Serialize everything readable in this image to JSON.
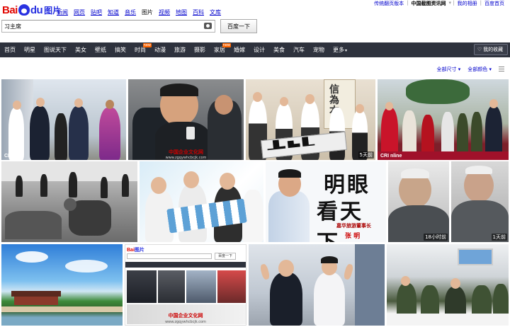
{
  "top_links": [
    "传统翻页版本",
    "中国截图资讯网",
    "我的相册",
    "百度首页"
  ],
  "logo": {
    "bai": "Bai",
    "du": "du",
    "tupian": "图片"
  },
  "channels": [
    "新闻",
    "网页",
    "贴吧",
    "知道",
    "音乐",
    "图片",
    "视频",
    "地图",
    "百科",
    "文库"
  ],
  "current_channel": "图片",
  "search": {
    "value": "习主席",
    "button": "百度一下"
  },
  "nav": [
    {
      "label": "首页"
    },
    {
      "label": "明星"
    },
    {
      "label": "图说天下"
    },
    {
      "label": "美女"
    },
    {
      "label": "壁纸"
    },
    {
      "label": "搞笑"
    },
    {
      "label": "时尚",
      "hot": "new"
    },
    {
      "label": "动漫"
    },
    {
      "label": "旅游"
    },
    {
      "label": "摄影"
    },
    {
      "label": "家居",
      "hot": "new"
    },
    {
      "label": "婚嫁"
    },
    {
      "label": "设计"
    },
    {
      "label": "美食"
    },
    {
      "label": "汽车"
    },
    {
      "label": "宠物"
    },
    {
      "label": "更多"
    }
  ],
  "favorites": "我的收藏",
  "filters": {
    "size": "全部尺寸",
    "color": "全部颜色"
  },
  "tiles": {
    "t1_wm": "CRI",
    "t2_wm": "中国企业文化网",
    "t2_url": "www.zgqywhcbcjk.com",
    "t3_badge": "5天前",
    "t4_wm": "CRI",
    "t4_wm_suffix": "nline",
    "t7_line1": "明眼",
    "t7_line2": "看天下",
    "t7_caption": "嘉华旅游董事长",
    "t7_name": "张 明",
    "t8_badge": "18小时前",
    "t9_badge": "1天前",
    "t11_mini_logo": "Bai",
    "t11_mini_tupian": "图片",
    "t11_mini_btn": "百度一下",
    "t11_wm": "中国企业文化网",
    "t11_url": "www.zgqywhcbcjk.com"
  }
}
